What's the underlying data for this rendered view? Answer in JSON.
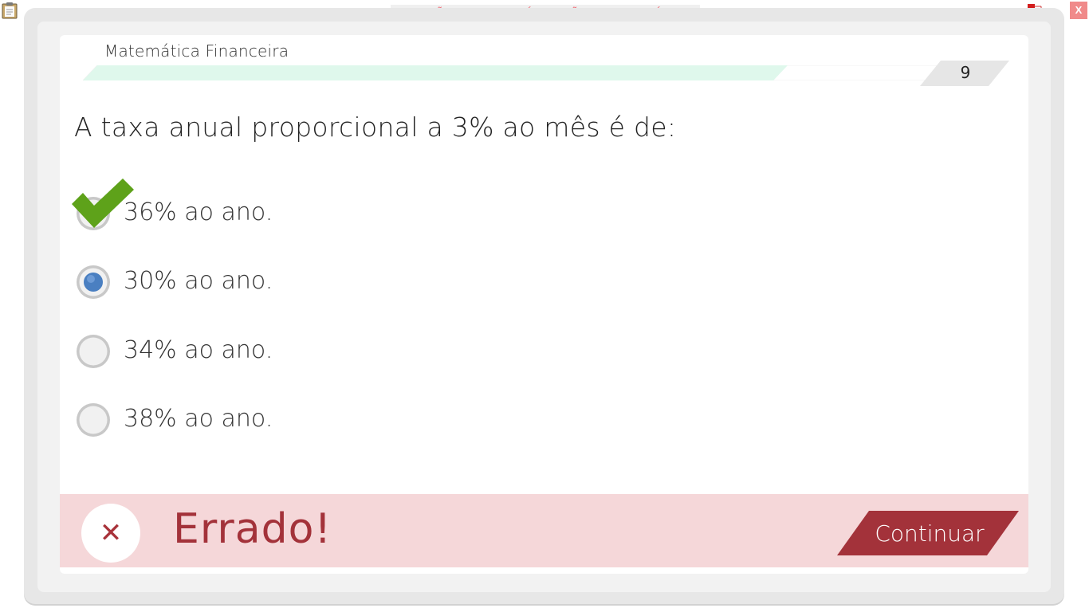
{
  "header": {
    "watermark": "VERSÃO PARA FUNCIONÁRIOS - NÃO COMERCIALIZÁVEL",
    "close_label": "X",
    "icons": [
      "clipboard-icon",
      "network-status-icon"
    ]
  },
  "lesson": {
    "subject": "Matemática Financeira",
    "page_number": "9",
    "progress_fraction": 0.8
  },
  "question": {
    "text": "A taxa anual proporcional a 3% ao mês é de:",
    "options": [
      {
        "label": "36% ao ano.",
        "state": "correct"
      },
      {
        "label": "30% ao ano.",
        "state": "selected"
      },
      {
        "label": "34% ao ano.",
        "state": "unselected"
      },
      {
        "label": "38% ao ano.",
        "state": "unselected"
      }
    ]
  },
  "feedback": {
    "result": "Errado!",
    "continue_label": "Continuar",
    "colors": {
      "bar": "#f5d7d9",
      "accent": "#a3323a",
      "correct_check": "#5ea21a",
      "selected_radio": "#4a7fc1"
    }
  }
}
